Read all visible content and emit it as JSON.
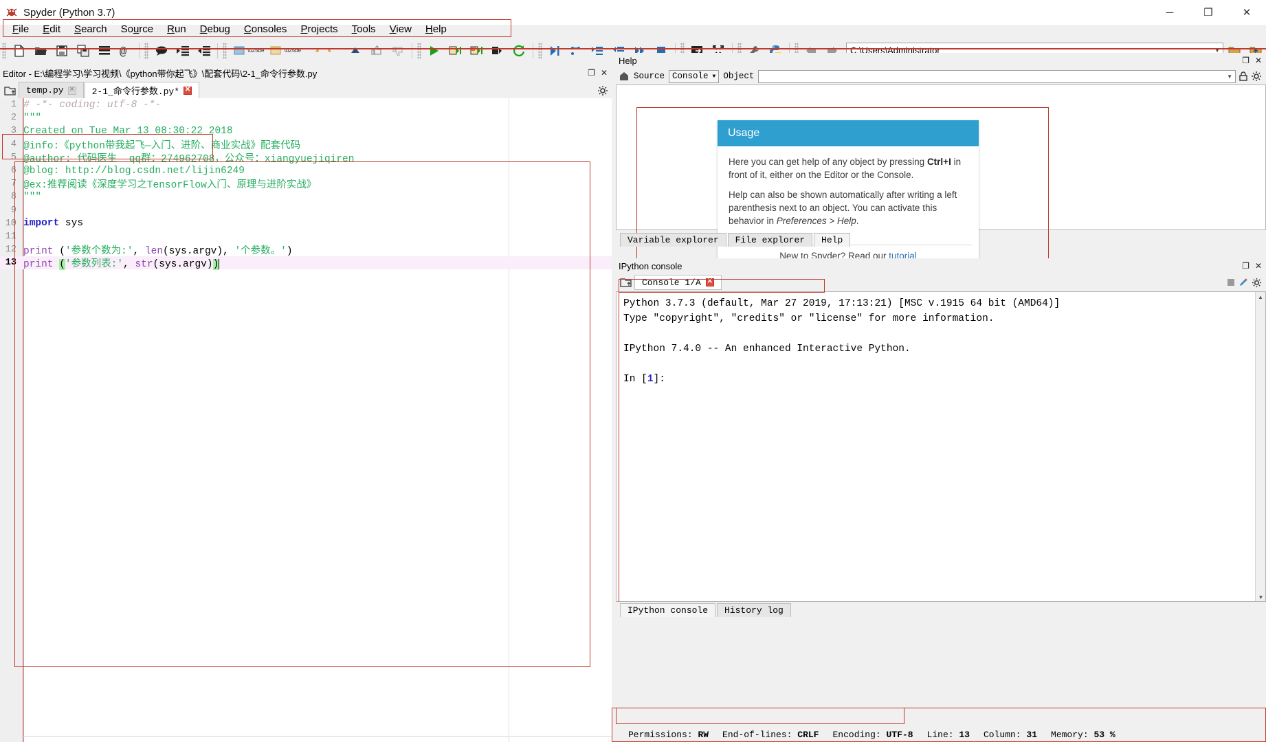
{
  "window": {
    "title": "Spyder (Python 3.7)",
    "app_icon": "spyder-logo-icon",
    "minimize": "─",
    "maximize": "❐",
    "close": "✕"
  },
  "menubar": {
    "items": [
      {
        "label": "File",
        "accel": "F"
      },
      {
        "label": "Edit",
        "accel": "E"
      },
      {
        "label": "Search",
        "accel": "S"
      },
      {
        "label": "Source",
        "accel": "u"
      },
      {
        "label": "Run",
        "accel": "R"
      },
      {
        "label": "Debug",
        "accel": "D"
      },
      {
        "label": "Consoles",
        "accel": "C"
      },
      {
        "label": "Projects",
        "accel": "P"
      },
      {
        "label": "Tools",
        "accel": "T"
      },
      {
        "label": "View",
        "accel": "V"
      },
      {
        "label": "Help",
        "accel": "H"
      }
    ]
  },
  "toolbar": {
    "buttons": [
      "new-file-icon",
      "open-file-icon",
      "save-file-icon",
      "save-all-icon",
      "file-list-icon",
      "find-in-files-icon",
      "comment-icon",
      "unindent-icon",
      "indent-icon",
      "run-cell-icon",
      "run-cell-advance-icon",
      "undo-icon",
      "redo-icon",
      "up-arrow-icon",
      "thumbs-up-icon",
      "thumbs-down-icon",
      "run-file-icon",
      "run-cell-green-icon",
      "run-cell-red-icon",
      "run-selection-icon",
      "rerun-icon",
      "debug-file-icon",
      "debug-step-icon",
      "debug-step-into-icon",
      "debug-step-return-icon",
      "debug-continue-icon",
      "debug-stop-icon",
      "maximize-pane-icon",
      "fullscreen-icon",
      "preferences-icon",
      "pythonpath-icon",
      "back-arrow-icon",
      "forward-arrow-icon"
    ],
    "path_value": "C:\\Users\\Administrator",
    "path_dropdown_icon": "chevron-down-icon",
    "browse_dir_icon": "folder-open-icon",
    "parent_dir_icon": "up-folder-icon"
  },
  "editor": {
    "panel_title": "Editor - E:\\编程学习\\学习视频\\《python带你起飞》\\配套代码\\2-1_命令行参数.py",
    "undock_icon": "undock-icon",
    "close_icon": "close-icon",
    "browse_tabs_icon": "browse-tabs-icon",
    "options_icon": "gear-icon",
    "tabs": [
      {
        "label": "temp.py",
        "modified": false,
        "active": false,
        "close_icon": "close-tab-icon"
      },
      {
        "label": "2-1_命令行参数.py*",
        "modified": true,
        "active": true,
        "close_icon": "close-tab-icon"
      }
    ],
    "lines": [
      {
        "n": "1",
        "tokens": [
          {
            "t": "# -*- coding: utf-8 -*-",
            "c": "comment"
          }
        ]
      },
      {
        "n": "2",
        "tokens": [
          {
            "t": "\"\"\"",
            "c": "str"
          }
        ]
      },
      {
        "n": "3",
        "tokens": [
          {
            "t": "Created on Tue Mar 13 08:30:22 2018",
            "c": "str"
          }
        ]
      },
      {
        "n": "4",
        "tokens": [
          {
            "t": "@info:《python带我起飞—入门、进阶、商业实战》配套代码",
            "c": "str"
          }
        ]
      },
      {
        "n": "5",
        "tokens": [
          {
            "t": "@author: 代码医生  qq群：274962708，公众号：xiangyuejiqiren",
            "c": "str"
          }
        ]
      },
      {
        "n": "6",
        "tokens": [
          {
            "t": "@blog: http://blog.csdn.net/lijin6249",
            "c": "str"
          }
        ]
      },
      {
        "n": "7",
        "tokens": [
          {
            "t": "@ex:推荐阅读《深度学习之TensorFlow入门、原理与进阶实战》",
            "c": "str"
          }
        ]
      },
      {
        "n": "8",
        "tokens": [
          {
            "t": "\"\"\"",
            "c": "str"
          }
        ]
      },
      {
        "n": "9",
        "tokens": [
          {
            "t": "",
            "c": "plain"
          }
        ]
      },
      {
        "n": "10",
        "tokens": [
          {
            "t": "import",
            "c": "kw"
          },
          {
            "t": " sys",
            "c": "plain"
          }
        ]
      },
      {
        "n": "11",
        "tokens": [
          {
            "t": "",
            "c": "plain"
          }
        ]
      },
      {
        "n": "12",
        "tokens": [
          {
            "t": "print",
            "c": "builtin"
          },
          {
            "t": " (",
            "c": "plain"
          },
          {
            "t": "'参数个数为:'",
            "c": "str"
          },
          {
            "t": ", ",
            "c": "plain"
          },
          {
            "t": "len",
            "c": "builtin"
          },
          {
            "t": "(sys.argv), ",
            "c": "plain"
          },
          {
            "t": "'个参数。'",
            "c": "str"
          },
          {
            "t": ")",
            "c": "plain"
          }
        ]
      },
      {
        "n": "13",
        "tokens": [
          {
            "t": "print",
            "c": "builtin"
          },
          {
            "t": " ",
            "c": "plain"
          },
          {
            "t": "(",
            "c": "paren"
          },
          {
            "t": "'参数列表:'",
            "c": "str"
          },
          {
            "t": ", ",
            "c": "plain"
          },
          {
            "t": "str",
            "c": "builtin"
          },
          {
            "t": "(sys.argv)",
            "c": "plain"
          },
          {
            "t": ")",
            "c": "paren"
          }
        ],
        "highlight": true,
        "current": true
      }
    ]
  },
  "help": {
    "panel_title": "Help",
    "undock_icon": "undock-icon",
    "close_icon": "close-icon",
    "home_icon": "help-home-icon",
    "source_label": "Source",
    "source_value": "Console",
    "source_caret_icon": "chevron-down-icon",
    "object_label": "Object",
    "object_value": "",
    "object_caret_icon": "chevron-down-icon",
    "lock_icon": "lock-icon",
    "options_icon": "gear-icon",
    "usage": {
      "title": "Usage",
      "p1_pre": "Here you can get help of any object by pressing ",
      "p1_key": "Ctrl+I",
      "p1_post": " in front of it, either on the Editor or the Console.",
      "p2_pre": "Help can also be shown automatically after writing a left parenthesis next to an object. You can activate this behavior in ",
      "p2_em": "Preferences > Help",
      "p2_post": ".",
      "footer_pre": "New to Spyder? Read our ",
      "footer_link": "tutorial"
    },
    "tabs": [
      {
        "label": "Variable explorer",
        "active": false
      },
      {
        "label": "File explorer",
        "active": false
      },
      {
        "label": "Help",
        "active": true
      }
    ]
  },
  "console": {
    "panel_title": "IPython console",
    "undock_icon": "undock-icon",
    "close_icon": "close-icon",
    "browse_tabs_icon": "browse-tabs-icon",
    "tab_label": "Console 1/A",
    "tab_close_icon": "close-tab-icon",
    "stop_icon": "stop-square-icon",
    "pencil_icon": "pencil-icon",
    "options_icon": "gear-icon",
    "scroll_up_icon": "chevron-up-icon",
    "scroll_down_icon": "chevron-down-icon",
    "lines": [
      "Python 3.7.3 (default, Mar 27 2019, 17:13:21) [MSC v.1915 64 bit (AMD64)]",
      "Type \"copyright\", \"credits\" or \"license\" for more information.",
      "",
      "IPython 7.4.0 -- An enhanced Interactive Python.",
      ""
    ],
    "prompt_pre": "In [",
    "prompt_num": "1",
    "prompt_post": "]:",
    "tabs": [
      {
        "label": "IPython console",
        "active": true
      },
      {
        "label": "History log",
        "active": false
      }
    ]
  },
  "statusbar": {
    "permissions_label": "Permissions:",
    "permissions_value": "RW",
    "eol_label": "End-of-lines:",
    "eol_value": "CRLF",
    "encoding_label": "Encoding:",
    "encoding_value": "UTF-8",
    "line_label": "Line:",
    "line_value": "13",
    "column_label": "Column:",
    "column_value": "31",
    "memory_label": "Memory:",
    "memory_value": "53 %"
  },
  "colors": {
    "accent_blue": "#2f9fd0",
    "annotation_red": "#c0392b",
    "string_green": "#27ae60",
    "keyword_blue": "#2222cc",
    "builtin_purple": "#8e44ad",
    "highlight_pink": "#faeefa"
  }
}
